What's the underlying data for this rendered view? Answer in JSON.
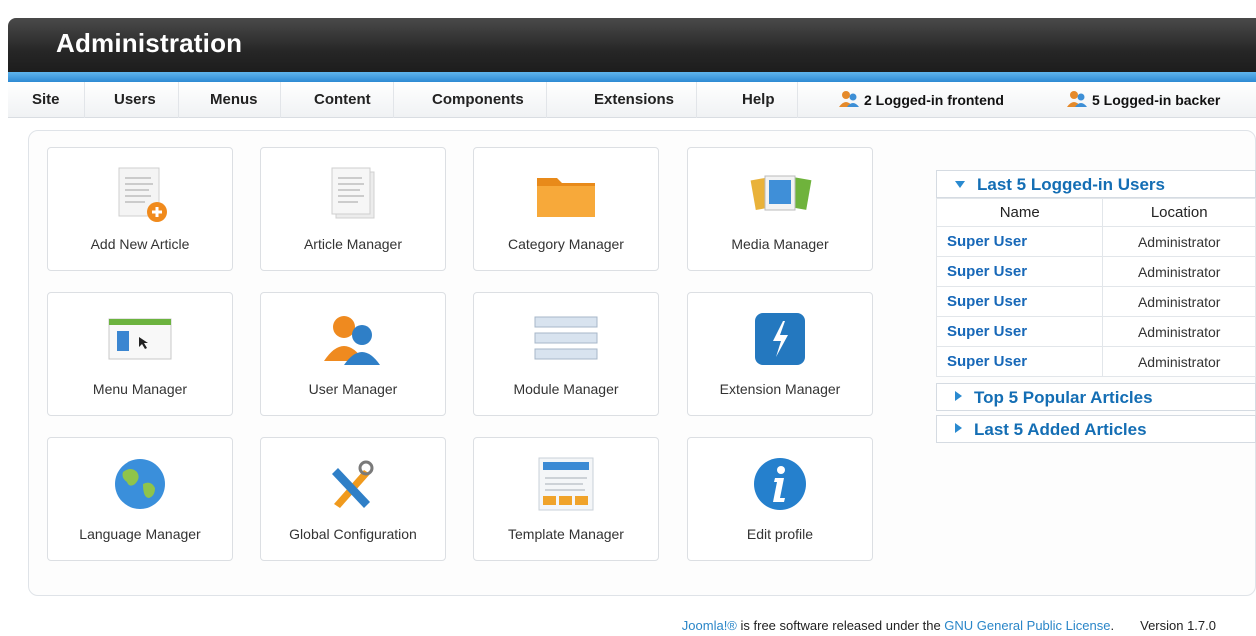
{
  "header": {
    "title": "Administration"
  },
  "menu": [
    {
      "label": "Site"
    },
    {
      "label": "Users"
    },
    {
      "label": "Menus"
    },
    {
      "label": "Content"
    },
    {
      "label": "Components"
    },
    {
      "label": "Extensions"
    },
    {
      "label": "Help"
    }
  ],
  "status": {
    "frontend": "2 Logged-in frontend",
    "backend": "5 Logged-in backer"
  },
  "tiles": [
    {
      "label": "Add New Article",
      "icon": "add-article-icon"
    },
    {
      "label": "Article Manager",
      "icon": "article-icon"
    },
    {
      "label": "Category Manager",
      "icon": "folder-icon"
    },
    {
      "label": "Media Manager",
      "icon": "media-icon"
    },
    {
      "label": "Menu Manager",
      "icon": "menu-icon"
    },
    {
      "label": "User Manager",
      "icon": "users-icon"
    },
    {
      "label": "Module Manager",
      "icon": "module-icon"
    },
    {
      "label": "Extension Manager",
      "icon": "extension-icon"
    },
    {
      "label": "Language Manager",
      "icon": "globe-icon"
    },
    {
      "label": "Global Configuration",
      "icon": "tools-icon"
    },
    {
      "label": "Template Manager",
      "icon": "template-icon"
    },
    {
      "label": "Edit profile",
      "icon": "info-icon"
    }
  ],
  "sidebar": {
    "logged_users": {
      "title": "Last 5 Logged-in Users",
      "col_name": "Name",
      "col_location": "Location",
      "rows": [
        {
          "name": "Super User",
          "location": "Administrator"
        },
        {
          "name": "Super User",
          "location": "Administrator"
        },
        {
          "name": "Super User",
          "location": "Administrator"
        },
        {
          "name": "Super User",
          "location": "Administrator"
        },
        {
          "name": "Super User",
          "location": "Administrator"
        }
      ]
    },
    "popular": {
      "title": "Top 5 Popular Articles"
    },
    "added": {
      "title": "Last 5 Added Articles"
    }
  },
  "footer": {
    "joomla": "Joomla!®",
    "text1": " is free software released under the ",
    "license": "GNU General Public License",
    "text2": ".",
    "version": "Version 1.7.0"
  },
  "colors": {
    "accent": "#2e8ad3",
    "link": "#1768b8",
    "header": "#262626"
  }
}
